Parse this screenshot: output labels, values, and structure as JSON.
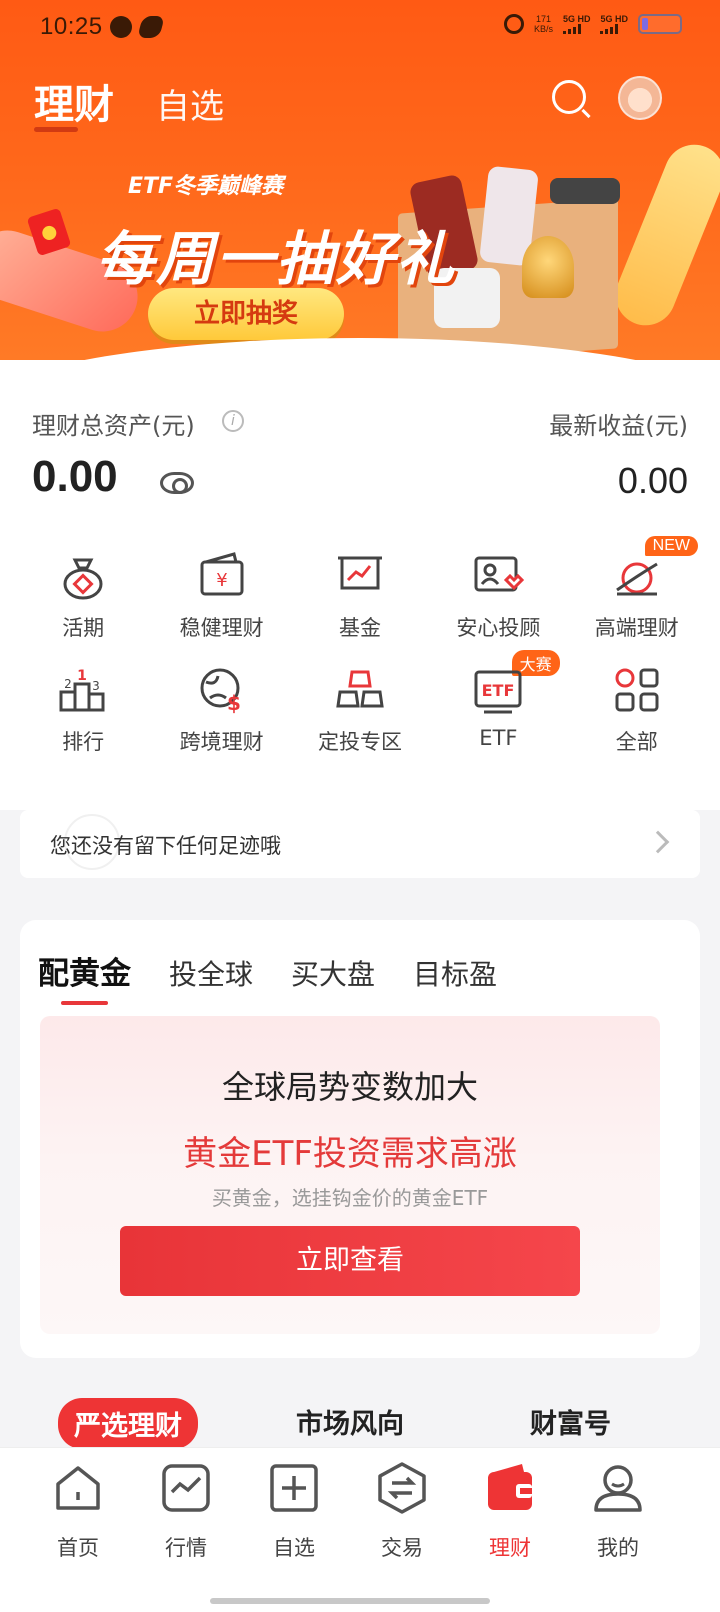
{
  "status_bar": {
    "time": "10:25",
    "net_speed_value": "171",
    "net_speed_unit": "KB/s",
    "sim1": "5G HD",
    "sim2": "5G HD"
  },
  "header": {
    "tab_active": "理财",
    "tab_inactive": "自选",
    "search_icon": "search-icon",
    "avatar_icon": "avatar"
  },
  "banner": {
    "title": "ETF冬季巅峰赛",
    "headline": "每周一抽好礼",
    "button": "立即抽奖"
  },
  "assets": {
    "total_label": "理财总资产(元)",
    "total_value": "0.00",
    "income_label": "最新收益(元)",
    "income_value": "0.00"
  },
  "grid": [
    {
      "label": "活期",
      "icon": "money-bag-icon"
    },
    {
      "label": "稳健理财",
      "icon": "wallet-yen-icon"
    },
    {
      "label": "基金",
      "icon": "chart-board-icon"
    },
    {
      "label": "安心投顾",
      "icon": "advisor-card-icon"
    },
    {
      "label": "高端理财",
      "icon": "premium-icon",
      "badge": "NEW"
    },
    {
      "label": "排行",
      "icon": "podium-icon"
    },
    {
      "label": "跨境理财",
      "icon": "globe-dollar-icon"
    },
    {
      "label": "定投专区",
      "icon": "gold-bars-icon"
    },
    {
      "label": "ETF",
      "icon": "etf-icon",
      "badge": "大赛"
    },
    {
      "label": "全部",
      "icon": "all-grid-icon"
    }
  ],
  "footprint": {
    "text": "您还没有留下任何足迹哦"
  },
  "card": {
    "tabs": [
      "配黄金",
      "投全球",
      "买大盘",
      "目标盈"
    ],
    "promo_title": "全球局势变数加大",
    "promo_headline": "黄金ETF投资需求高涨",
    "promo_sub": "买黄金，选挂钩金价的黄金ETF",
    "promo_button": "立即查看"
  },
  "section_tabs": [
    "严选理财",
    "市场风向",
    "财富号"
  ],
  "bottom_nav": [
    {
      "label": "首页",
      "icon": "home-icon"
    },
    {
      "label": "行情",
      "icon": "market-chart-icon"
    },
    {
      "label": "自选",
      "icon": "add-favorite-icon"
    },
    {
      "label": "交易",
      "icon": "exchange-icon"
    },
    {
      "label": "理财",
      "icon": "wallet-icon",
      "active": true
    },
    {
      "label": "我的",
      "icon": "profile-icon"
    }
  ],
  "colors": {
    "brand_orange": "#ff5a14",
    "accent_red": "#ee3435"
  }
}
